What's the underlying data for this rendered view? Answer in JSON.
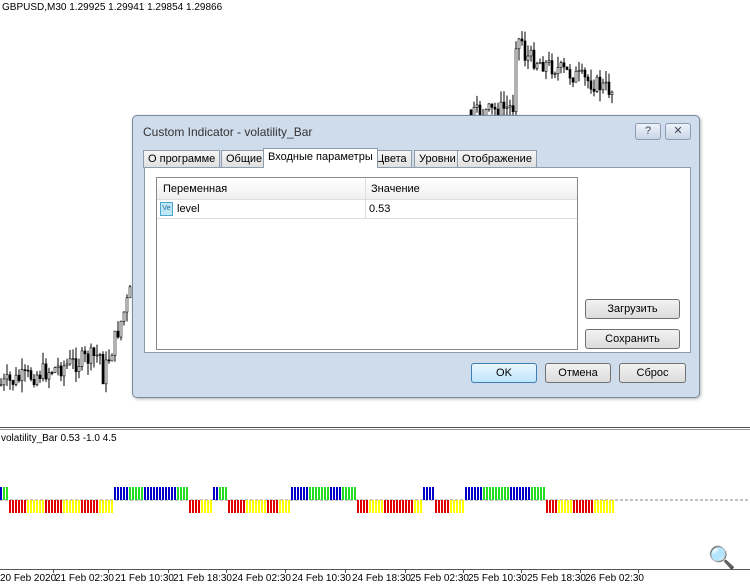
{
  "chart": {
    "symbol_line": "GBPUSD,M30  1.29925 1.29941 1.29854 1.29866",
    "indicator_label": "volatility_Bar 0.53   -1.0 4.5",
    "time_labels": [
      "20 Feb 2020",
      "21 Feb 02:30",
      "21 Feb 10:30",
      "21 Feb 18:30",
      "24 Feb 02:30",
      "24 Feb 10:30",
      "24 Feb 18:30",
      "25 Feb 02:30",
      "25 Feb 10:30",
      "25 Feb 18:30",
      "26 Feb 02:30"
    ],
    "colors": {
      "blue": "#0000c8",
      "green": "#22dd22",
      "red": "#e00000",
      "yellow": "#ffff00",
      "candle": "#000000"
    },
    "indicator_level": 0.53,
    "indicator_segments": [
      [
        "blue",
        1
      ],
      [
        "green",
        2
      ],
      [
        "red",
        6
      ],
      [
        "yellow",
        6
      ],
      [
        "red",
        6
      ],
      [
        "yellow",
        6
      ],
      [
        "red",
        6
      ],
      [
        "yellow",
        5
      ],
      [
        "blue",
        5
      ],
      [
        "green",
        5
      ],
      [
        "blue",
        11
      ],
      [
        "green",
        4
      ],
      [
        "red",
        4
      ],
      [
        "yellow",
        4
      ],
      [
        "blue",
        2
      ],
      [
        "green",
        3
      ],
      [
        "red",
        6
      ],
      [
        "yellow",
        7
      ],
      [
        "red",
        4
      ],
      [
        "yellow",
        4
      ],
      [
        "blue",
        6
      ],
      [
        "green",
        7
      ],
      [
        "blue",
        4
      ],
      [
        "green",
        5
      ],
      [
        "red",
        4
      ],
      [
        "yellow",
        5
      ],
      [
        "red",
        10
      ],
      [
        "yellow",
        3
      ],
      [
        "blue",
        4
      ],
      [
        "red",
        5
      ],
      [
        "yellow",
        5
      ],
      [
        "blue",
        6
      ],
      [
        "green",
        9
      ],
      [
        "blue",
        7
      ],
      [
        "green",
        5
      ],
      [
        "red",
        4
      ],
      [
        "yellow",
        5
      ],
      [
        "red",
        7
      ],
      [
        "yellow",
        7
      ]
    ],
    "zoom_icon": "magnifier-plus-icon"
  },
  "dialog": {
    "title": "Custom Indicator - volatility_Bar",
    "help": "?",
    "close": "✕",
    "tabs": [
      {
        "label": "О программе"
      },
      {
        "label": "Общие"
      },
      {
        "label": "Входные параметры",
        "active": true
      },
      {
        "label": "Цвета"
      },
      {
        "label": "Уровни"
      },
      {
        "label": "Отображение"
      }
    ],
    "table": {
      "headers": [
        "Переменная",
        "Значение"
      ],
      "rows": [
        {
          "icon": "Ve",
          "name": "level",
          "value": "0.53"
        }
      ]
    },
    "load": "Загрузить",
    "save": "Сохранить",
    "ok": "OK",
    "cancel": "Отмена",
    "reset": "Сброс"
  }
}
